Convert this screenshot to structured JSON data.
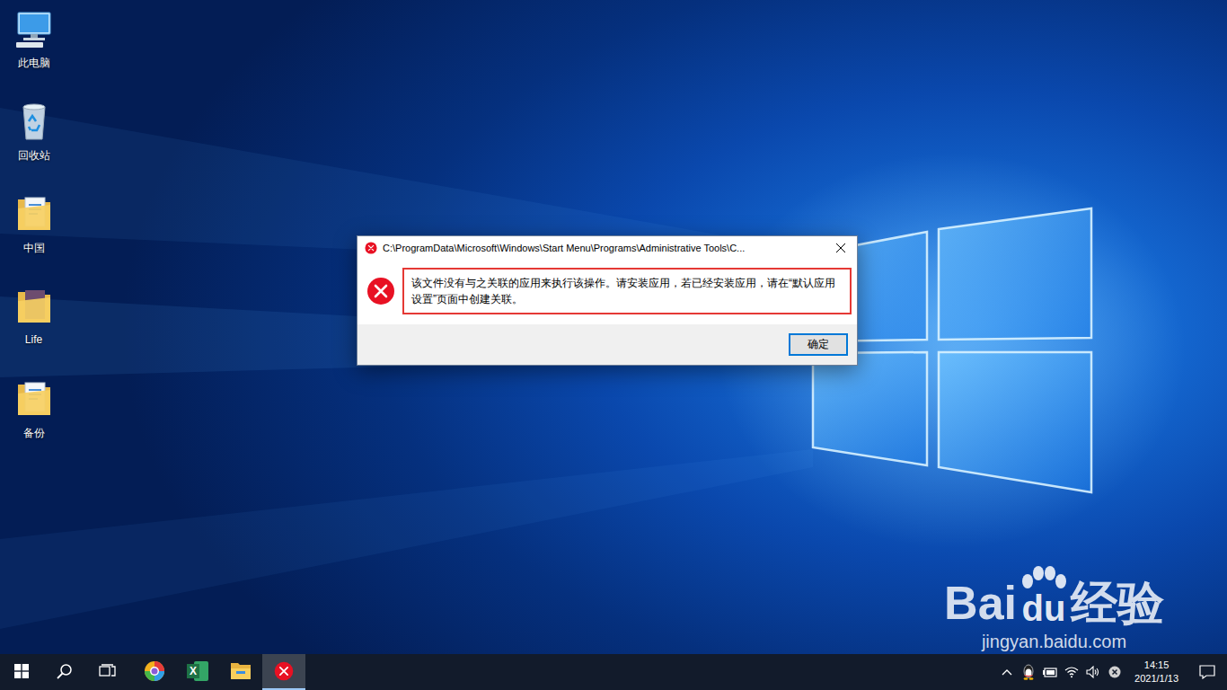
{
  "desktop": {
    "icons": [
      {
        "label": "此电脑",
        "kind": "computer"
      },
      {
        "label": "回收站",
        "kind": "recycle"
      },
      {
        "label": "中国",
        "kind": "folder"
      },
      {
        "label": "Life",
        "kind": "photo-folder"
      },
      {
        "label": "备份",
        "kind": "folder"
      }
    ]
  },
  "dialog": {
    "title": "C:\\ProgramData\\Microsoft\\Windows\\Start Menu\\Programs\\Administrative Tools\\C...",
    "message": "该文件没有与之关联的应用来执行该操作。请安装应用，若已经安装应用，请在“默认应用设置”页面中创建关联。",
    "highlighted": true,
    "buttons": [
      {
        "label": "确定",
        "default": true
      }
    ]
  },
  "taskbar": {
    "apps": [
      {
        "kind": "browser",
        "active": false
      },
      {
        "kind": "excel",
        "glyph": "X",
        "active": false
      },
      {
        "kind": "explorer",
        "active": false
      },
      {
        "kind": "error",
        "active": true
      }
    ],
    "tray": {
      "time": "14:15",
      "date": "2021/1/13"
    }
  },
  "watermark": {
    "brand_left": "Bai",
    "brand_right": "du",
    "brand_cn": "经验",
    "url": "jingyan.baidu.com"
  }
}
